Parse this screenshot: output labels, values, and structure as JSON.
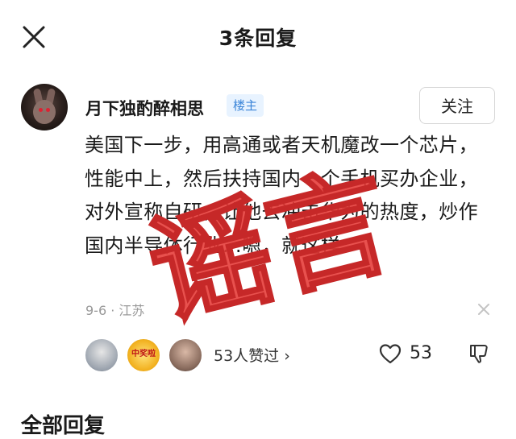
{
  "header": {
    "title": "3条回复",
    "close_icon": "close-icon"
  },
  "post": {
    "author": "月下独酌醉相思",
    "badge": "楼主",
    "follow_label": "关注",
    "body": "美国下一步，用高通或者天机魔改一个芯片，性能中上，然后扶持国内一个手机买办企业，对外宣称自研，让他去冲击华为的热度，炒作国内半导体行业…嗯，就这样",
    "meta": "9-6 · 江苏",
    "likers_text": "53人赞过 ›",
    "like_count": "53",
    "liker_badge_text": "中奖啦"
  },
  "overlay": {
    "stamp_text": "谣言",
    "stamp_color": "#e53935"
  },
  "section": {
    "title": "全部回复"
  }
}
